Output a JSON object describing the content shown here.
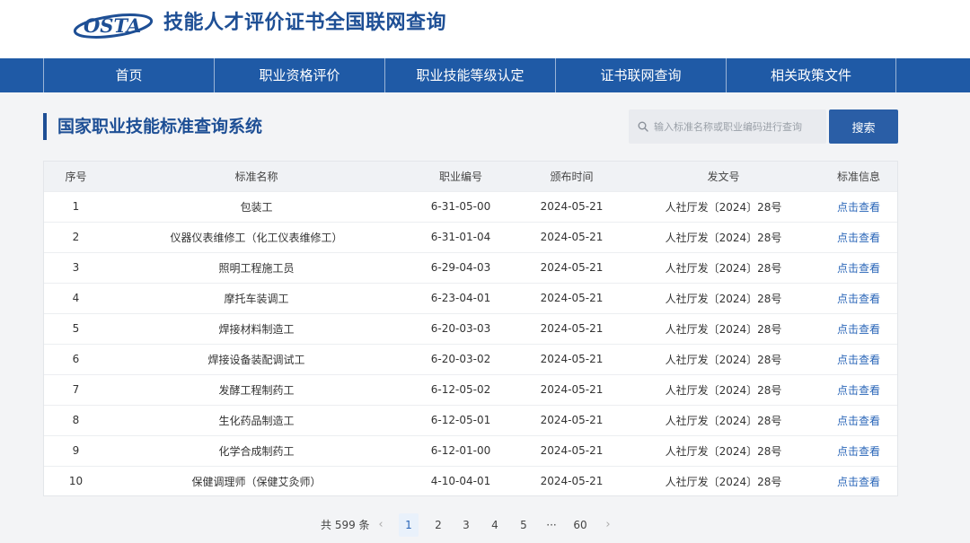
{
  "header": {
    "logo_text": "OSTA",
    "site_title": "技能人才评价证书全国联网查询"
  },
  "nav": [
    "首页",
    "职业资格评价",
    "职业技能等级认定",
    "证书联网查询",
    "相关政策文件"
  ],
  "section": {
    "title": "国家职业技能标准查询系统"
  },
  "search": {
    "placeholder": "输入标准名称或职业编码进行查询",
    "button_label": "搜索"
  },
  "table": {
    "headers": [
      "序号",
      "标准名称",
      "职业编号",
      "颁布时间",
      "发文号",
      "标准信息"
    ],
    "rows": [
      [
        "1",
        "包装工",
        "6-31-05-00",
        "2024-05-21",
        "人社厅发〔2024〕28号",
        "点击查看"
      ],
      [
        "2",
        "仪器仪表维修工（化工仪表维修工）",
        "6-31-01-04",
        "2024-05-21",
        "人社厅发〔2024〕28号",
        "点击查看"
      ],
      [
        "3",
        "照明工程施工员",
        "6-29-04-03",
        "2024-05-21",
        "人社厅发〔2024〕28号",
        "点击查看"
      ],
      [
        "4",
        "摩托车装调工",
        "6-23-04-01",
        "2024-05-21",
        "人社厅发〔2024〕28号",
        "点击查看"
      ],
      [
        "5",
        "焊接材料制造工",
        "6-20-03-03",
        "2024-05-21",
        "人社厅发〔2024〕28号",
        "点击查看"
      ],
      [
        "6",
        "焊接设备装配调试工",
        "6-20-03-02",
        "2024-05-21",
        "人社厅发〔2024〕28号",
        "点击查看"
      ],
      [
        "7",
        "发酵工程制药工",
        "6-12-05-02",
        "2024-05-21",
        "人社厅发〔2024〕28号",
        "点击查看"
      ],
      [
        "8",
        "生化药品制造工",
        "6-12-05-01",
        "2024-05-21",
        "人社厅发〔2024〕28号",
        "点击查看"
      ],
      [
        "9",
        "化学合成制药工",
        "6-12-01-00",
        "2024-05-21",
        "人社厅发〔2024〕28号",
        "点击查看"
      ],
      [
        "10",
        "保健调理师（保健艾灸师）",
        "4-10-04-01",
        "2024-05-21",
        "人社厅发〔2024〕28号",
        "点击查看"
      ]
    ]
  },
  "pagination": {
    "total_label": "共 599 条",
    "prev": "‹",
    "next": "›",
    "pages": [
      "1",
      "2",
      "3",
      "4",
      "5",
      "···",
      "60"
    ],
    "current": "1"
  },
  "colors": {
    "brand": "#1e4f95",
    "nav_bg": "#1f5aa6",
    "link": "#2a66b8",
    "page_bg": "#f3f4f6"
  }
}
